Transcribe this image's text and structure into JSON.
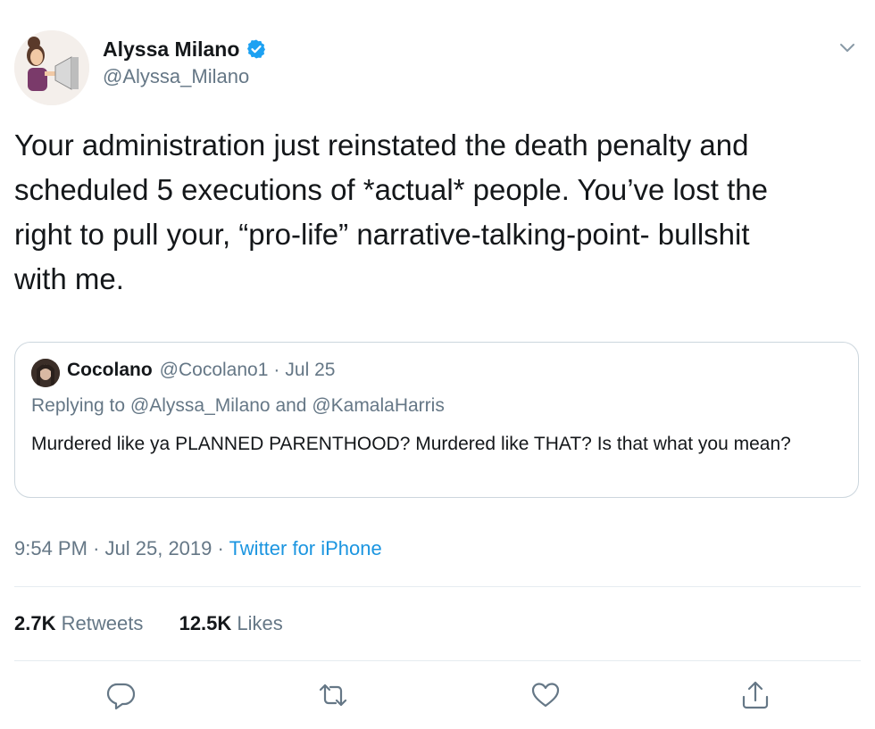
{
  "author": {
    "name": "Alyssa Milano",
    "handle": "@Alyssa_Milano",
    "verified": true
  },
  "tweet": {
    "text": "Your administration just reinstated the death penalty and\nscheduled 5 executions of *actual* people. You’ve lost the\nright to pull your, “pro-life” narrative-talking-point- bullshit\nwith me."
  },
  "quoted": {
    "name": "Cocolano",
    "handle": "@Cocolano1",
    "separator": "·",
    "date": "Jul 25",
    "replying_to": "Replying to @Alyssa_Milano and @KamalaHarris",
    "text": "Murdered like ya PLANNED PARENTHOOD? Murdered like THAT? Is that what you mean?"
  },
  "meta": {
    "time": "9:54 PM",
    "date": "Jul 25, 2019",
    "separator": "·",
    "source": "Twitter for iPhone"
  },
  "stats": {
    "retweets_count": "2.7K",
    "retweets_label": "Retweets",
    "likes_count": "12.5K",
    "likes_label": "Likes"
  },
  "actions": {
    "icons": [
      "reply-icon",
      "retweet-icon",
      "like-icon",
      "share-icon"
    ]
  },
  "colors": {
    "accent": "#1b95e0",
    "muted": "#657786",
    "text": "#14171a",
    "border": "#ccd6dd",
    "verified": "#1da1f2"
  }
}
